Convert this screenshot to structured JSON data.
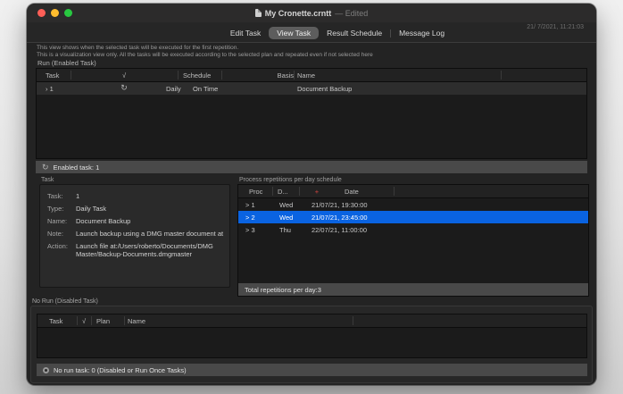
{
  "window": {
    "title": "My Cronette.crntt",
    "edited_suffix": "— Edited",
    "timestamp": "21/ 7/2021, 11:21:03"
  },
  "tabs": {
    "edit_task": "Edit Task",
    "view_task": "View Task",
    "result_schedule": "Result Schedule",
    "message_log": "Message Log"
  },
  "description": {
    "line1": "This view shows when the selected task will be executed for the first repetition.",
    "line2": "This is a visualization view only. All the tasks will be executed according to the selected plan and repeated even if not selected here"
  },
  "run_section": {
    "title": "Run (Enabled Task)",
    "headers": {
      "task": "Task",
      "check": "√",
      "schedule": "Schedule",
      "basis": "Basis",
      "name": "Name"
    },
    "row": {
      "task": "› 1",
      "repeat_icon": "↻",
      "schedule": "Daily",
      "basis": "On Time",
      "name": "Document Backup"
    },
    "status": {
      "icon": "↻",
      "label": "Enabled task: 1"
    }
  },
  "task_panel": {
    "title": "Task",
    "fields": [
      {
        "label": "Task:",
        "value": "1"
      },
      {
        "label": "Type:",
        "value": "Daily Task"
      },
      {
        "label": "Name:",
        "value": "Document Backup"
      },
      {
        "label": "Note:",
        "value": "Launch backup using a DMG master document at"
      },
      {
        "label": "Action:",
        "value": "Launch file at:/Users/roberto/Documents/DMG Master/Backup-Documents.dmgmaster"
      }
    ]
  },
  "repetitions": {
    "title": "Process repetitions per day schedule",
    "headers": {
      "proc": "Proc",
      "day": "D...",
      "plus": "+",
      "date": "Date"
    },
    "rows": [
      {
        "proc": "> 1",
        "day": "Wed",
        "date": "21/07/21, 19:30:00"
      },
      {
        "proc": "> 2",
        "day": "Wed",
        "date": "21/07/21, 23:45:00"
      },
      {
        "proc": "> 3",
        "day": "Thu",
        "date": "22/07/21, 11:00:00"
      }
    ],
    "footer": "Total repetitions per day:3"
  },
  "no_run_section": {
    "title": "No Run (Disabled Task)",
    "headers": {
      "task": "Task",
      "check": "√",
      "plan": "Plan",
      "name": "Name"
    },
    "status": "No run task: 0 (Disabled or Run Once Tasks)"
  },
  "colors": {
    "selection_blue": "#0a63e1",
    "plus_red": "#d64541",
    "traffic_red": "#ff5f57",
    "traffic_yellow": "#febc2e",
    "traffic_green": "#28c840"
  }
}
